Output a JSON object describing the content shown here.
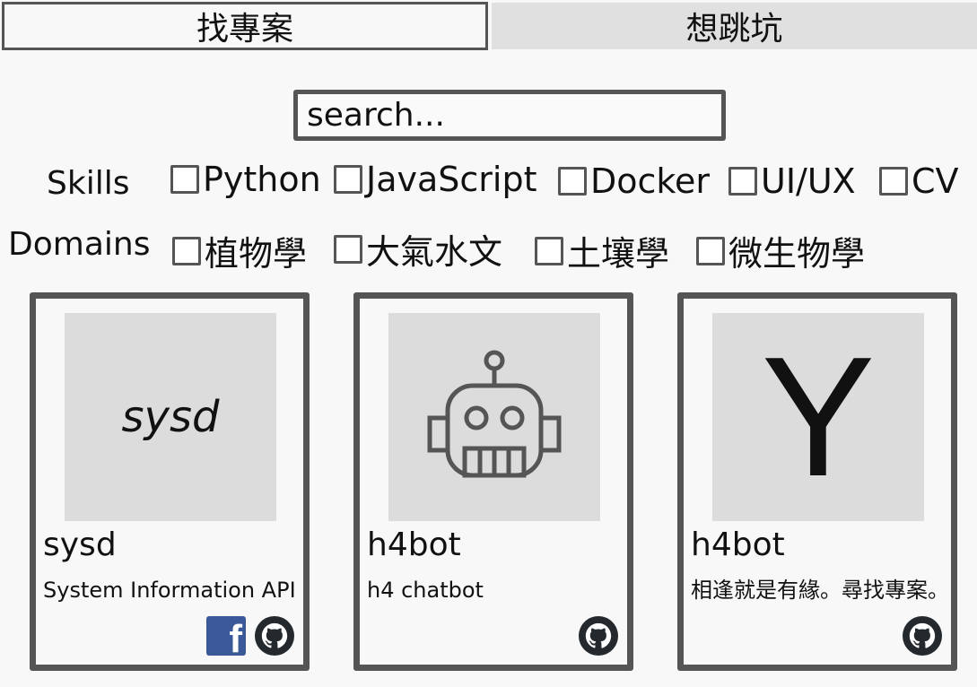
{
  "tabs": [
    {
      "label": "找專案",
      "active": true
    },
    {
      "label": "想跳坑",
      "active": false
    }
  ],
  "search": {
    "placeholder": "search..."
  },
  "skills": {
    "label": "Skills",
    "options": [
      "Python",
      "JavaScript",
      "Docker",
      "UI/UX",
      "CV"
    ]
  },
  "domains": {
    "label": "Domains",
    "options": [
      "植物學",
      "大氣水文",
      "土壤學",
      "微生物學"
    ]
  },
  "cards": [
    {
      "thumb_text": "sysd",
      "title": "sysd",
      "description": "System Information API",
      "icons": [
        "facebook-icon",
        "github-icon"
      ]
    },
    {
      "thumb_icon": "robot-icon",
      "title": "h4bot",
      "description": "h4 chatbot",
      "icons": [
        "github-icon"
      ]
    },
    {
      "thumb_text": "Y",
      "title": "h4bot",
      "description": "相逢就是有緣。尋找專案。",
      "icons": [
        "github-icon"
      ]
    }
  ],
  "colors": {
    "border": "#555555",
    "thumb_bg": "#dcdcdc",
    "inactive_tab": "#e0e0e0",
    "facebook": "#3b5998",
    "github": "#24292e"
  }
}
